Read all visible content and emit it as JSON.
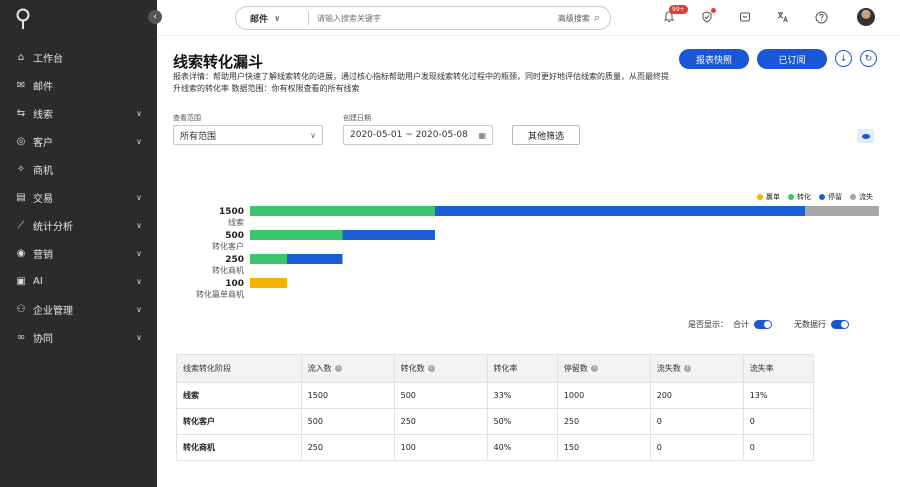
{
  "sidebar": {
    "items": [
      {
        "label": "工作台",
        "icon": "home-icon",
        "has_children": false
      },
      {
        "label": "邮件",
        "icon": "mail-icon",
        "has_children": false
      },
      {
        "label": "线索",
        "icon": "lead-icon",
        "has_children": true
      },
      {
        "label": "客户",
        "icon": "customer-icon",
        "has_children": true
      },
      {
        "label": "商机",
        "icon": "opportunity-icon",
        "has_children": false
      },
      {
        "label": "交易",
        "icon": "deal-icon",
        "has_children": true
      },
      {
        "label": "统计分析",
        "icon": "analytics-icon",
        "has_children": true
      },
      {
        "label": "营销",
        "icon": "marketing-icon",
        "has_children": true
      },
      {
        "label": "AI",
        "icon": "ai-icon",
        "has_children": true
      },
      {
        "label": "企业管理",
        "icon": "org-icon",
        "has_children": true
      },
      {
        "label": "协同",
        "icon": "collab-icon",
        "has_children": true
      }
    ]
  },
  "search": {
    "scope": "邮件",
    "placeholder": "请输入搜索关键字",
    "advanced": "高级搜索"
  },
  "topbar": {
    "notification_badge": "99+"
  },
  "page": {
    "title": "线索转化漏斗",
    "description": "报表详情：帮助用户快速了解线索转化的进展，通过核心指标帮助用户发现线索转化过程中的瓶颈，同时更好地评估线索的质量，从而最终提升线索的转化率 数据范围：你有权限查看的所有线索",
    "snapshot_btn": "报表快照",
    "subscribed_btn": "已订阅"
  },
  "filters": {
    "scope_label": "查看范围",
    "scope_value": "所有范围",
    "date_label": "创建日期",
    "date_value": "2020-05-01 ~ 2020-05-08",
    "other_btn": "其他筛选"
  },
  "legend": [
    {
      "name": "赢单",
      "color": "#f5b400"
    },
    {
      "name": "转化",
      "color": "#3bc46a"
    },
    {
      "name": "停留",
      "color": "#1a5fd6"
    },
    {
      "name": "流失",
      "color": "#a6a6a6"
    }
  ],
  "chart_data": {
    "type": "bar",
    "orientation": "horizontal",
    "stacked": true,
    "categories": [
      "线索",
      "转化客户",
      "转化商机",
      "转化赢单商机"
    ],
    "totals": [
      1500,
      500,
      250,
      100
    ],
    "series": [
      {
        "name": "赢单",
        "values": [
          0,
          0,
          0,
          100
        ]
      },
      {
        "name": "转化",
        "values": [
          500,
          250,
          100,
          0
        ]
      },
      {
        "name": "停留",
        "values": [
          1000,
          250,
          150,
          0
        ]
      },
      {
        "name": "流失",
        "values": [
          200,
          0,
          0,
          0
        ]
      }
    ],
    "xlim": [
      0,
      1700
    ],
    "grid": false,
    "legend_position": "top-right"
  },
  "display": {
    "label": "是否显示：",
    "total": "合计",
    "no_data_rows": "无数据行"
  },
  "table": {
    "headers": [
      "线索转化阶段",
      "流入数",
      "转化数",
      "转化率",
      "停留数",
      "流失数",
      "流失率"
    ],
    "rows": [
      [
        "线索",
        "1500",
        "500",
        "33%",
        "1000",
        "200",
        "13%"
      ],
      [
        "转化客户",
        "500",
        "250",
        "50%",
        "250",
        "0",
        "0"
      ],
      [
        "转化商机",
        "250",
        "100",
        "40%",
        "150",
        "0",
        "0"
      ]
    ]
  }
}
